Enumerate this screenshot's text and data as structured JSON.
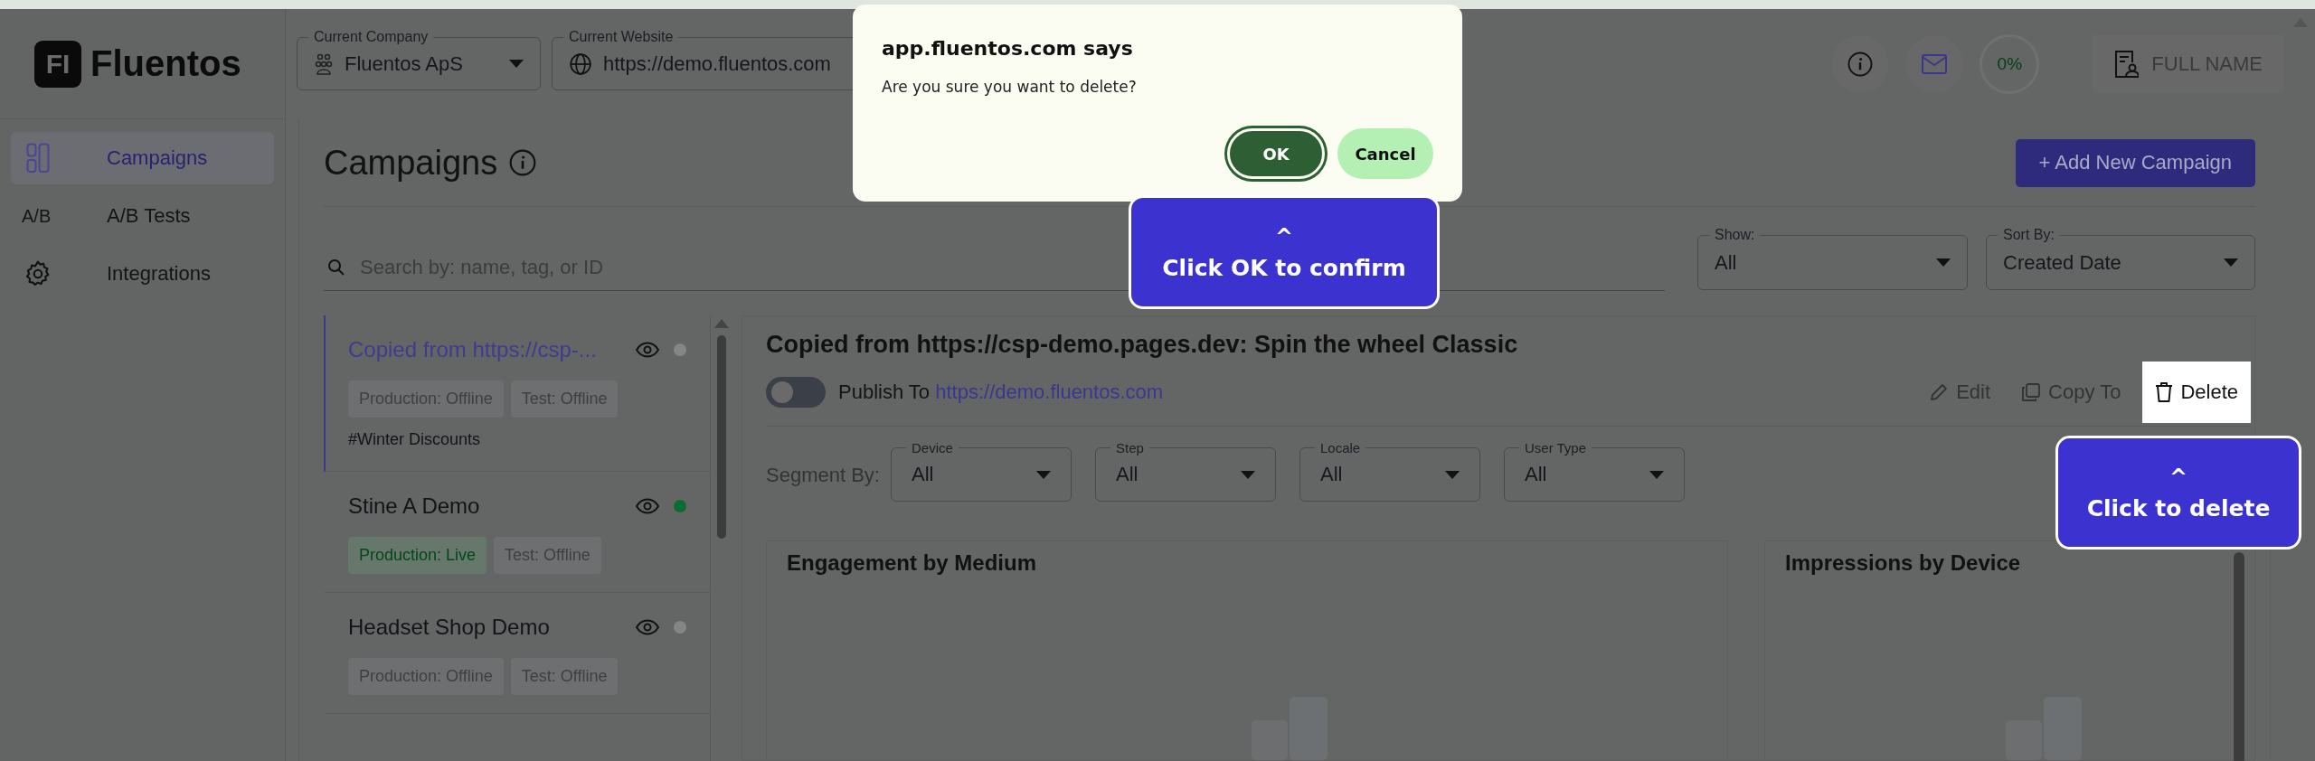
{
  "logo": {
    "mark": "FI",
    "text": "Fluentos"
  },
  "sidebar": {
    "items": [
      {
        "kind": "grid",
        "label": "Campaigns",
        "selected": true
      },
      {
        "kind": "text",
        "icon_text": "A/B",
        "label": "A/B Tests",
        "selected": false
      },
      {
        "kind": "gear",
        "label": "Integrations",
        "selected": false
      }
    ]
  },
  "top_bar": {
    "company": {
      "label": "Current Company",
      "value": "Fluentos ApS"
    },
    "website": {
      "label": "Current Website",
      "value": "https://demo.fluentos.com"
    },
    "progress": "0%",
    "user": "FULL NAME"
  },
  "page": {
    "title": "Campaigns",
    "add_button": "+ Add New Campaign"
  },
  "filters": {
    "search_placeholder": "Search by: name, tag, or ID",
    "show": {
      "label": "Show:",
      "value": "All"
    },
    "sort": {
      "label": "Sort By:",
      "value": "Created Date"
    }
  },
  "campaigns": [
    {
      "name": "Copied from https://csp-...",
      "selected": true,
      "live": false,
      "badges": [
        {
          "text": "Production: Offline",
          "live": false
        },
        {
          "text": "Test: Offline",
          "live": false
        }
      ],
      "tag": "#Winter Discounts"
    },
    {
      "name": "Stine A Demo",
      "selected": false,
      "live": true,
      "badges": [
        {
          "text": "Production: Live",
          "live": true
        },
        {
          "text": "Test: Offline",
          "live": false
        }
      ]
    },
    {
      "name": "Headset Shop Demo",
      "selected": false,
      "live": false,
      "badges": [
        {
          "text": "Production: Offline",
          "live": false
        },
        {
          "text": "Test: Offline",
          "live": false
        }
      ]
    }
  ],
  "detail": {
    "title": "Copied from https://csp-demo.pages.dev: Spin the wheel Classic",
    "published": false,
    "publish_label": "Publish To",
    "publish_url": "https://demo.fluentos.com",
    "actions": [
      {
        "kind": "edit",
        "label": "Edit",
        "highlighted": false
      },
      {
        "kind": "copy",
        "label": "Copy To",
        "highlighted": false
      },
      {
        "kind": "delete",
        "label": "Delete",
        "highlighted": true
      }
    ],
    "segment_label": "Segment By:",
    "segments": [
      {
        "label": "Device",
        "value": "All"
      },
      {
        "label": "Step",
        "value": "All"
      },
      {
        "label": "Locale",
        "value": "All"
      },
      {
        "label": "User Type",
        "value": "All"
      }
    ],
    "charts": [
      {
        "title": "Engagement by Medium"
      },
      {
        "title": "Impressions by Device"
      }
    ]
  },
  "dialog": {
    "title": "app.fluentos.com says",
    "message": "Are you sure you want to delete?",
    "buttons": [
      {
        "label": "OK",
        "kind": "primary"
      },
      {
        "label": "Cancel",
        "kind": "secondary"
      }
    ]
  },
  "hints": [
    {
      "arrow": "^",
      "text": "Click OK to confirm"
    },
    {
      "arrow": "^",
      "text": "Click to delete"
    }
  ]
}
